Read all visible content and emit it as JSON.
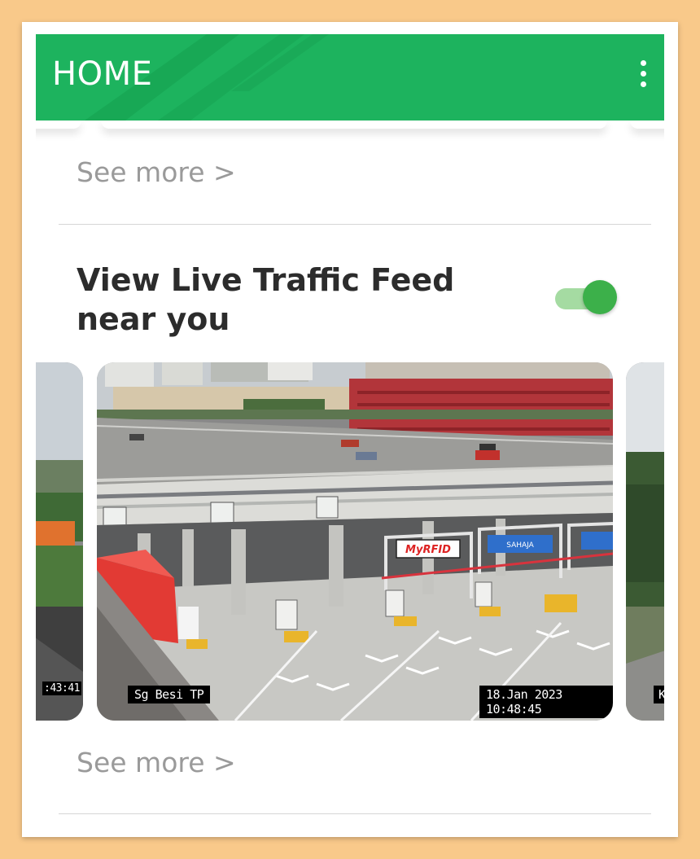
{
  "appbar": {
    "title": "HOME",
    "menu_icon": "more-vert-icon",
    "background": "#1db35e"
  },
  "sections": {
    "previous": {
      "see_more": "See more >"
    },
    "live_traffic": {
      "title": "View Live Traffic Feed near you",
      "toggle_on": true,
      "see_more": "See more >"
    }
  },
  "cameras": [
    {
      "timestamp": ":43:41"
    },
    {
      "location": "Sg Besi TP",
      "timestamp": "18.Jan 2023  10:48:45",
      "sign_text": "MyRFID",
      "lane_sign": "SAHAJA"
    },
    {
      "location": "K"
    }
  ],
  "colors": {
    "accent": "#1db35e",
    "toggle_knob": "#3cb04a",
    "toggle_track": "#a5dba2"
  }
}
